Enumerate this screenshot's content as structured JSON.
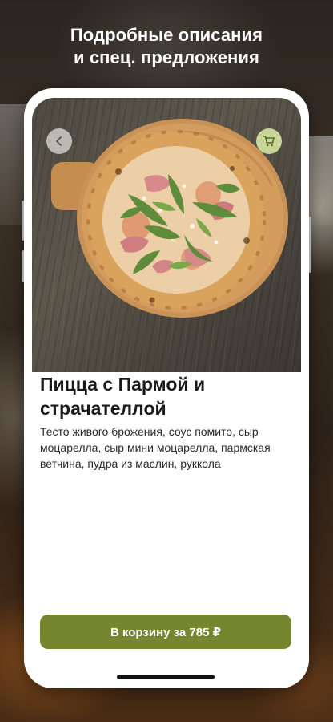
{
  "headline": {
    "line1": "Подробные описания",
    "line2": "и спец. предложения"
  },
  "icons": {
    "back": "chevron-left-icon",
    "cart": "shopping-cart-icon"
  },
  "product": {
    "title": "Пицца с Пармой и страчателлой",
    "description": "Тесто живого брожения, соус помито, сыр моцарелла, сыр мини моцарелла, пармская ветчина, пудра из маслин, руккола",
    "button_label": "В корзину за 785 ₽"
  },
  "colors": {
    "accent": "#76862f",
    "cart_button_bg": "#c9d59a",
    "text": "#1a1a1a"
  }
}
